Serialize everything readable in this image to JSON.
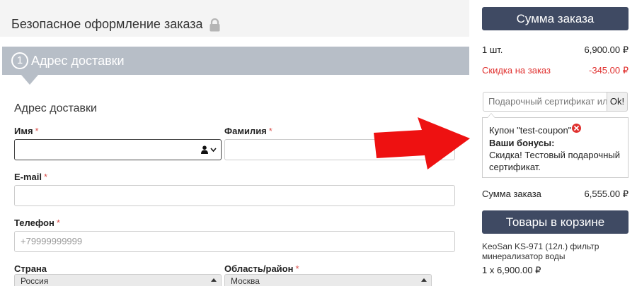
{
  "header": {
    "title": "Безопасное оформление заказа",
    "lock_icon": "lock-icon"
  },
  "step": {
    "number": "1",
    "title": "Адрес доставки"
  },
  "form": {
    "section_title": "Адрес доставки",
    "required_mark": "*",
    "first_name": {
      "label": "Имя",
      "value": ""
    },
    "last_name": {
      "label": "Фамилия",
      "value": ""
    },
    "email": {
      "label": "E-mail",
      "value": ""
    },
    "phone": {
      "label": "Телефон",
      "placeholder": "+79999999999"
    },
    "country": {
      "label": "Страна",
      "selected": "Россия"
    },
    "region": {
      "label": "Область/район",
      "selected": "Москва"
    }
  },
  "summary": {
    "header": "Сумма заказа",
    "qty_label": "1 шт.",
    "qty_value": "6,900.00 ₽",
    "discount_label": "Скидка на заказ",
    "discount_value": "-345.00 ₽",
    "certificate_placeholder": "Подарочный сертификат или",
    "ok_label": "Ok!",
    "coupon_text": "Купон \"test-coupon\"",
    "bonuses_title": "Ваши бонусы:",
    "bonus_line1": "Скидка! Тестовый подарочный",
    "bonus_line2": "сертификат.",
    "total_label": "Сумма заказа",
    "total_value": "6,555.00 ₽"
  },
  "cart": {
    "header": "Товары в корзине",
    "product_name": "KeoSan KS-971 (12л.) фильтр минерализатор воды",
    "product_qty": "1 x 6,900.00 ₽"
  },
  "colors": {
    "dark_button": "#3f4a63",
    "step_bar": "#b7bec7",
    "discount_red": "#e0302e",
    "arrow_red": "#ee1111"
  }
}
